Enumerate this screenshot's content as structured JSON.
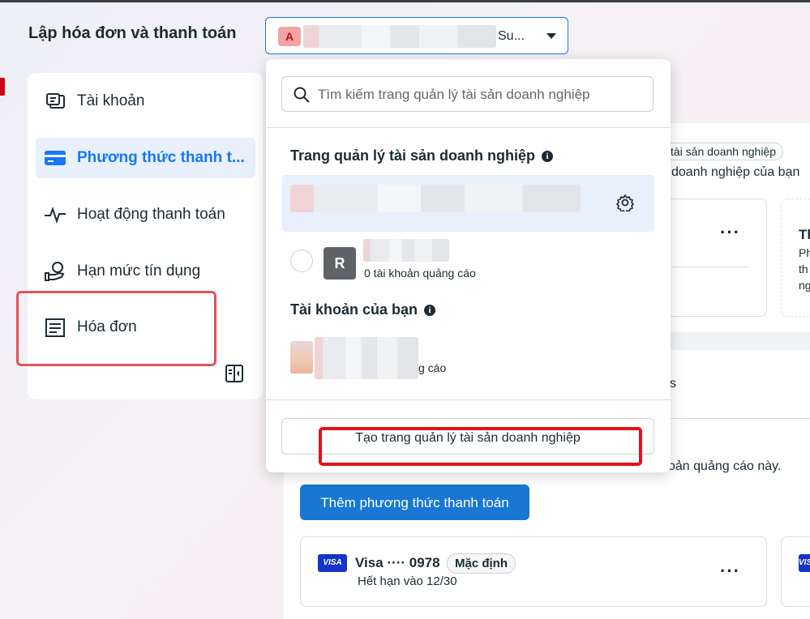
{
  "header": {
    "title": "Lập hóa đơn và thanh toán",
    "account_selector": {
      "avatar_letter": "A",
      "name_suffix": "Su..."
    }
  },
  "sidebar": {
    "items": [
      {
        "label": "Tài khoản",
        "icon": "accounts-icon",
        "active": false
      },
      {
        "label": "Phương thức thanh t...",
        "icon": "credit-card-icon",
        "active": true
      },
      {
        "label": "Hoạt động thanh toán",
        "icon": "activity-pulse-icon",
        "active": false
      },
      {
        "label": "Hạn mức tín dụng",
        "icon": "credit-limit-icon",
        "active": false
      },
      {
        "label": "Hóa đơn",
        "icon": "invoice-icon",
        "active": false
      }
    ],
    "collapse_icon": "collapse-sidebar-icon"
  },
  "dropdown": {
    "search_placeholder": "Tìm kiếm trang quản lý tài sản doanh nghiệp",
    "business_section_title": "Trang quản lý tài sản doanh nghiệp",
    "business_second_row": {
      "avatar_letter": "R",
      "subtitle": "0 tài khoản quảng cáo"
    },
    "your_accounts_title": "Tài khoản của bạn",
    "your_account_row": {
      "subtitle_visible": "g cáo"
    },
    "create_button": "Tạo trang quản lý tài sản doanh nghiệp"
  },
  "main": {
    "chip_text": "tài sản doanh nghiệp",
    "line_text": "doanh nghiệp của bạn",
    "right_card_lines": [
      "Th",
      "Ph",
      "th",
      "ng"
    ],
    "tab_fragment": "s",
    "notice_fragment": "oản quảng cáo này.",
    "add_payment_button": "Thêm phương thức thanh toán",
    "payment_method": {
      "brand_badge": "VISA",
      "label": "Visa ···· 0978",
      "default_chip": "Mặc định",
      "expiry": "Hết hạn vào 12/30"
    },
    "more_icon": "···"
  },
  "colors": {
    "accent": "#1877f2",
    "button": "#1877d2",
    "highlight_red": "#e8101a",
    "visa_blue": "#1434cb"
  }
}
